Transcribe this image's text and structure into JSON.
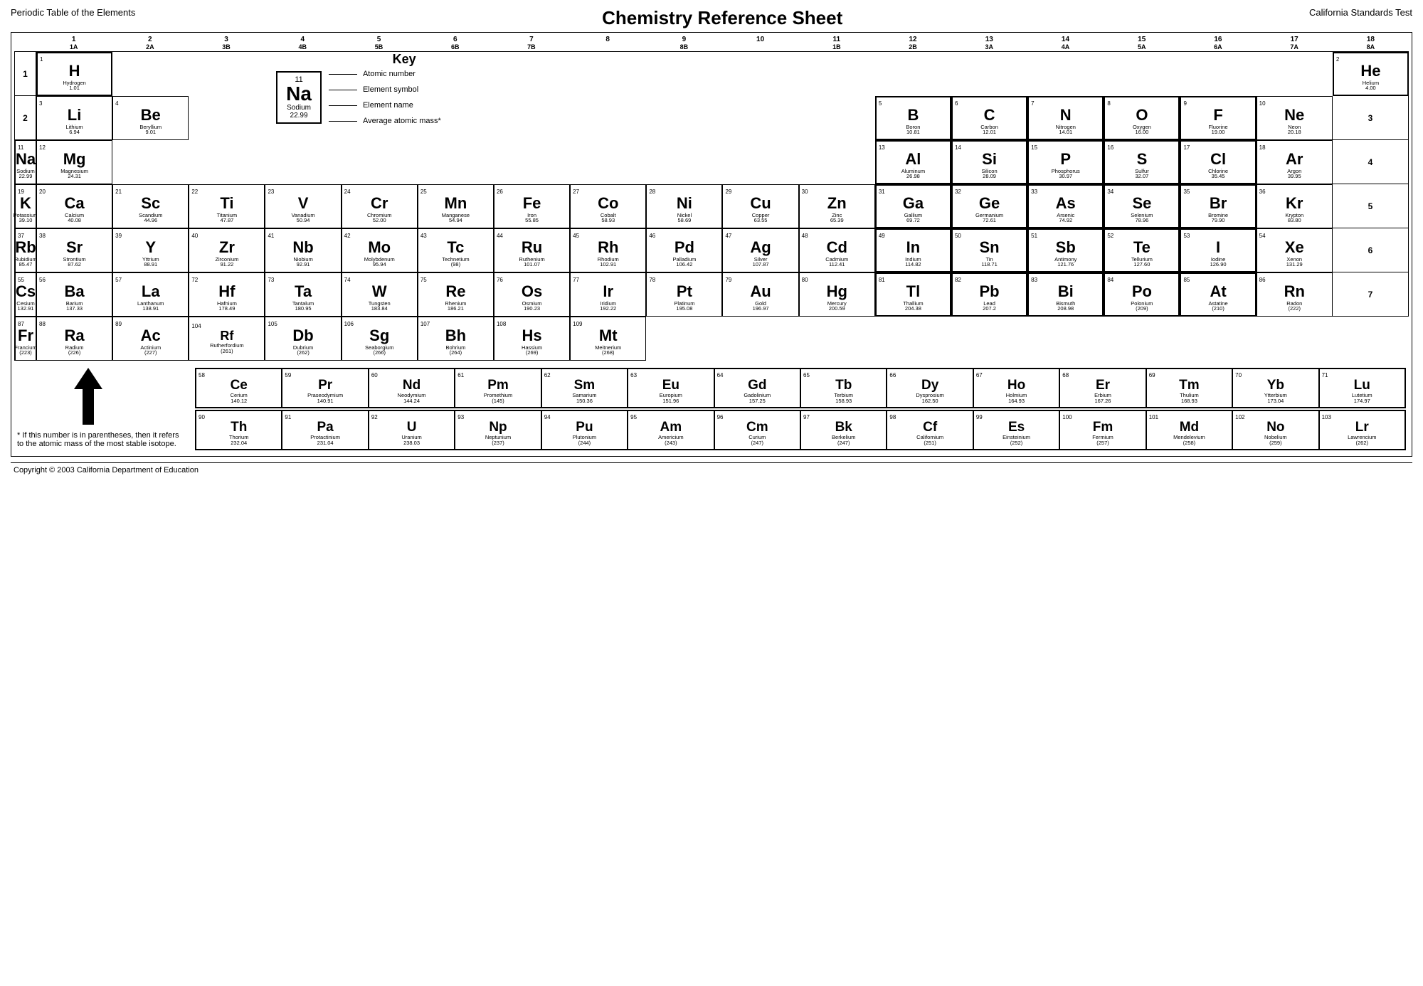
{
  "header": {
    "left": "Periodic Table of the Elements",
    "center": "Chemistry Reference Sheet",
    "right": "California Standards Test"
  },
  "key": {
    "title": "Key",
    "atomic_number_label": "Atomic number",
    "symbol_label": "Element symbol",
    "name_label": "Element name",
    "mass_label": "Average atomic mass*",
    "example": {
      "number": "11",
      "symbol": "Na",
      "name": "Sodium",
      "mass": "22.99"
    }
  },
  "footnote": "* If this number is in parentheses, then it refers to the atomic mass of the most stable isotope.",
  "copyright": "Copyright © 2003 California Department of Education",
  "groups": [
    "1",
    "2",
    "3",
    "4",
    "5",
    "6",
    "7",
    "8",
    "9",
    "10",
    "11",
    "12",
    "13",
    "14",
    "15",
    "16",
    "17",
    "18"
  ],
  "group_labels": [
    "1A",
    "2A",
    "",
    "",
    "",
    "",
    "",
    "",
    "8B",
    "",
    "",
    "",
    "3A",
    "4A",
    "5A",
    "6A",
    "7A",
    "8A"
  ],
  "group_sublabels": [
    "",
    "",
    "3B",
    "4B",
    "5B",
    "6B",
    "7B",
    "",
    "8B",
    "",
    "1B",
    "2B",
    "",
    "",
    "",
    "",
    "",
    ""
  ],
  "periods": [
    1,
    2,
    3,
    4,
    5,
    6,
    7
  ],
  "elements": {
    "H": {
      "number": 1,
      "symbol": "H",
      "name": "Hydrogen",
      "mass": "1.01"
    },
    "He": {
      "number": 2,
      "symbol": "He",
      "name": "Helium",
      "mass": "4.00"
    },
    "Li": {
      "number": 3,
      "symbol": "Li",
      "name": "Lithium",
      "mass": "6.94"
    },
    "Be": {
      "number": 4,
      "symbol": "Be",
      "name": "Beryllium",
      "mass": "9.01"
    },
    "B": {
      "number": 5,
      "symbol": "B",
      "name": "Boron",
      "mass": "10.81"
    },
    "C": {
      "number": 6,
      "symbol": "C",
      "name": "Carbon",
      "mass": "12.01"
    },
    "N": {
      "number": 7,
      "symbol": "N",
      "name": "Nitrogen",
      "mass": "14.01"
    },
    "O": {
      "number": 8,
      "symbol": "O",
      "name": "Oxygen",
      "mass": "16.00"
    },
    "F": {
      "number": 9,
      "symbol": "F",
      "name": "Fluorine",
      "mass": "19.00"
    },
    "Ne": {
      "number": 10,
      "symbol": "Ne",
      "name": "Neon",
      "mass": "20.18"
    },
    "Na": {
      "number": 11,
      "symbol": "Na",
      "name": "Sodium",
      "mass": "22.99"
    },
    "Mg": {
      "number": 12,
      "symbol": "Mg",
      "name": "Magnesium",
      "mass": "24.31"
    },
    "Al": {
      "number": 13,
      "symbol": "Al",
      "name": "Aluminum",
      "mass": "26.98"
    },
    "Si": {
      "number": 14,
      "symbol": "Si",
      "name": "Silicon",
      "mass": "28.09"
    },
    "P": {
      "number": 15,
      "symbol": "P",
      "name": "Phosphorus",
      "mass": "30.97"
    },
    "S": {
      "number": 16,
      "symbol": "S",
      "name": "Sulfur",
      "mass": "32.07"
    },
    "Cl": {
      "number": 17,
      "symbol": "Cl",
      "name": "Chlorine",
      "mass": "35.45"
    },
    "Ar": {
      "number": 18,
      "symbol": "Ar",
      "name": "Argon",
      "mass": "39.95"
    },
    "K": {
      "number": 19,
      "symbol": "K",
      "name": "Potassium",
      "mass": "39.10"
    },
    "Ca": {
      "number": 20,
      "symbol": "Ca",
      "name": "Calcium",
      "mass": "40.08"
    },
    "Sc": {
      "number": 21,
      "symbol": "Sc",
      "name": "Scandium",
      "mass": "44.96"
    },
    "Ti": {
      "number": 22,
      "symbol": "Ti",
      "name": "Titanium",
      "mass": "47.87"
    },
    "V": {
      "number": 23,
      "symbol": "V",
      "name": "Vanadium",
      "mass": "50.94"
    },
    "Cr": {
      "number": 24,
      "symbol": "Cr",
      "name": "Chromium",
      "mass": "52.00"
    },
    "Mn": {
      "number": 25,
      "symbol": "Mn",
      "name": "Manganese",
      "mass": "54.94"
    },
    "Fe": {
      "number": 26,
      "symbol": "Fe",
      "name": "Iron",
      "mass": "55.85"
    },
    "Co": {
      "number": 27,
      "symbol": "Co",
      "name": "Cobalt",
      "mass": "58.93"
    },
    "Ni": {
      "number": 28,
      "symbol": "Ni",
      "name": "Nickel",
      "mass": "58.69"
    },
    "Cu": {
      "number": 29,
      "symbol": "Cu",
      "name": "Copper",
      "mass": "63.55"
    },
    "Zn": {
      "number": 30,
      "symbol": "Zn",
      "name": "Zinc",
      "mass": "65.39"
    },
    "Ga": {
      "number": 31,
      "symbol": "Ga",
      "name": "Gallium",
      "mass": "69.72"
    },
    "Ge": {
      "number": 32,
      "symbol": "Ge",
      "name": "Germanium",
      "mass": "72.61"
    },
    "As": {
      "number": 33,
      "symbol": "As",
      "name": "Arsenic",
      "mass": "74.92"
    },
    "Se": {
      "number": 34,
      "symbol": "Se",
      "name": "Selenium",
      "mass": "78.96"
    },
    "Br": {
      "number": 35,
      "symbol": "Br",
      "name": "Bromine",
      "mass": "79.90"
    },
    "Kr": {
      "number": 36,
      "symbol": "Kr",
      "name": "Krypton",
      "mass": "83.80"
    },
    "Rb": {
      "number": 37,
      "symbol": "Rb",
      "name": "Rubidium",
      "mass": "85.47"
    },
    "Sr": {
      "number": 38,
      "symbol": "Sr",
      "name": "Strontium",
      "mass": "87.62"
    },
    "Y": {
      "number": 39,
      "symbol": "Y",
      "name": "Yttrium",
      "mass": "88.91"
    },
    "Zr": {
      "number": 40,
      "symbol": "Zr",
      "name": "Zirconium",
      "mass": "91.22"
    },
    "Nb": {
      "number": 41,
      "symbol": "Nb",
      "name": "Niobium",
      "mass": "92.91"
    },
    "Mo": {
      "number": 42,
      "symbol": "Mo",
      "name": "Molybdenum",
      "mass": "95.94"
    },
    "Tc": {
      "number": 43,
      "symbol": "Tc",
      "name": "Technetium",
      "mass": "(98)"
    },
    "Ru": {
      "number": 44,
      "symbol": "Ru",
      "name": "Ruthenium",
      "mass": "101.07"
    },
    "Rh": {
      "number": 45,
      "symbol": "Rh",
      "name": "Rhodium",
      "mass": "102.91"
    },
    "Pd": {
      "number": 46,
      "symbol": "Pd",
      "name": "Palladium",
      "mass": "106.42"
    },
    "Ag": {
      "number": 47,
      "symbol": "Ag",
      "name": "Silver",
      "mass": "107.87"
    },
    "Cd": {
      "number": 48,
      "symbol": "Cd",
      "name": "Cadmium",
      "mass": "112.41"
    },
    "In": {
      "number": 49,
      "symbol": "In",
      "name": "Indium",
      "mass": "114.82"
    },
    "Sn": {
      "number": 50,
      "symbol": "Sn",
      "name": "Tin",
      "mass": "118.71"
    },
    "Sb": {
      "number": 51,
      "symbol": "Sb",
      "name": "Antimony",
      "mass": "121.76"
    },
    "Te": {
      "number": 52,
      "symbol": "Te",
      "name": "Tellurium",
      "mass": "127.60"
    },
    "I": {
      "number": 53,
      "symbol": "I",
      "name": "Iodine",
      "mass": "126.90"
    },
    "Xe": {
      "number": 54,
      "symbol": "Xe",
      "name": "Xenon",
      "mass": "131.29"
    },
    "Cs": {
      "number": 55,
      "symbol": "Cs",
      "name": "Cesium",
      "mass": "132.91"
    },
    "Ba": {
      "number": 56,
      "symbol": "Ba",
      "name": "Barium",
      "mass": "137.33"
    },
    "La": {
      "number": 57,
      "symbol": "La",
      "name": "Lanthanum",
      "mass": "138.91"
    },
    "Hf": {
      "number": 72,
      "symbol": "Hf",
      "name": "Hafnium",
      "mass": "178.49"
    },
    "Ta": {
      "number": 73,
      "symbol": "Ta",
      "name": "Tantalum",
      "mass": "180.95"
    },
    "W": {
      "number": 74,
      "symbol": "W",
      "name": "Tungsten",
      "mass": "183.84"
    },
    "Re": {
      "number": 75,
      "symbol": "Re",
      "name": "Rhenium",
      "mass": "186.21"
    },
    "Os": {
      "number": 76,
      "symbol": "Os",
      "name": "Osmium",
      "mass": "190.23"
    },
    "Ir": {
      "number": 77,
      "symbol": "Ir",
      "name": "Iridium",
      "mass": "192.22"
    },
    "Pt": {
      "number": 78,
      "symbol": "Pt",
      "name": "Platinum",
      "mass": "195.08"
    },
    "Au": {
      "number": 79,
      "symbol": "Au",
      "name": "Gold",
      "mass": "196.97"
    },
    "Hg": {
      "number": 80,
      "symbol": "Hg",
      "name": "Mercury",
      "mass": "200.59"
    },
    "Tl": {
      "number": 81,
      "symbol": "Tl",
      "name": "Thallium",
      "mass": "204.38"
    },
    "Pb": {
      "number": 82,
      "symbol": "Pb",
      "name": "Lead",
      "mass": "207.2"
    },
    "Bi": {
      "number": 83,
      "symbol": "Bi",
      "name": "Bismuth",
      "mass": "208.98"
    },
    "Po": {
      "number": 84,
      "symbol": "Po",
      "name": "Polonium",
      "mass": "(209)"
    },
    "At": {
      "number": 85,
      "symbol": "At",
      "name": "Astatine",
      "mass": "(210)"
    },
    "Rn": {
      "number": 86,
      "symbol": "Rn",
      "name": "Radon",
      "mass": "(222)"
    },
    "Fr": {
      "number": 87,
      "symbol": "Fr",
      "name": "Francium",
      "mass": "(223)"
    },
    "Ra": {
      "number": 88,
      "symbol": "Ra",
      "name": "Radium",
      "mass": "(226)"
    },
    "Ac": {
      "number": 89,
      "symbol": "Ac",
      "name": "Actinium",
      "mass": "(227)"
    },
    "Rf": {
      "number": 104,
      "symbol": "Rf",
      "name": "Rutherfordium",
      "mass": "(261)"
    },
    "Db": {
      "number": 105,
      "symbol": "Db",
      "name": "Dubrium",
      "mass": "(262)"
    },
    "Sg": {
      "number": 106,
      "symbol": "Sg",
      "name": "Seaborgium",
      "mass": "(266)"
    },
    "Bh": {
      "number": 107,
      "symbol": "Bh",
      "name": "Bohrium",
      "mass": "(264)"
    },
    "Hs": {
      "number": 108,
      "symbol": "Hs",
      "name": "Hassium",
      "mass": "(269)"
    },
    "Mt": {
      "number": 109,
      "symbol": "Mt",
      "name": "Meitnerium",
      "mass": "(268)"
    },
    "Ce": {
      "number": 58,
      "symbol": "Ce",
      "name": "Cerium",
      "mass": "140.12"
    },
    "Pr": {
      "number": 59,
      "symbol": "Pr",
      "name": "Praseodymium",
      "mass": "140.91"
    },
    "Nd": {
      "number": 60,
      "symbol": "Nd",
      "name": "Neodymium",
      "mass": "144.24"
    },
    "Pm": {
      "number": 61,
      "symbol": "Pm",
      "name": "Promethium",
      "mass": "(145)"
    },
    "Sm": {
      "number": 62,
      "symbol": "Sm",
      "name": "Samarium",
      "mass": "150.36"
    },
    "Eu": {
      "number": 63,
      "symbol": "Eu",
      "name": "Europium",
      "mass": "151.96"
    },
    "Gd": {
      "number": 64,
      "symbol": "Gd",
      "name": "Gadolinium",
      "mass": "157.25"
    },
    "Tb": {
      "number": 65,
      "symbol": "Tb",
      "name": "Terbium",
      "mass": "158.93"
    },
    "Dy": {
      "number": 66,
      "symbol": "Dy",
      "name": "Dysprosium",
      "mass": "162.50"
    },
    "Ho": {
      "number": 67,
      "symbol": "Ho",
      "name": "Holmium",
      "mass": "164.93"
    },
    "Er": {
      "number": 68,
      "symbol": "Er",
      "name": "Erbium",
      "mass": "167.26"
    },
    "Tm": {
      "number": 69,
      "symbol": "Tm",
      "name": "Thulium",
      "mass": "168.93"
    },
    "Yb": {
      "number": 70,
      "symbol": "Yb",
      "name": "Ytterbium",
      "mass": "173.04"
    },
    "Lu": {
      "number": 71,
      "symbol": "Lu",
      "name": "Lutetium",
      "mass": "174.97"
    },
    "Th": {
      "number": 90,
      "symbol": "Th",
      "name": "Thorium",
      "mass": "232.04"
    },
    "Pa": {
      "number": 91,
      "symbol": "Pa",
      "name": "Protactinium",
      "mass": "231.04"
    },
    "U": {
      "number": 92,
      "symbol": "U",
      "name": "Uranium",
      "mass": "238.03"
    },
    "Np": {
      "number": 93,
      "symbol": "Np",
      "name": "Neptunium",
      "mass": "(237)"
    },
    "Pu": {
      "number": 94,
      "symbol": "Pu",
      "name": "Plutonium",
      "mass": "(244)"
    },
    "Am": {
      "number": 95,
      "symbol": "Am",
      "name": "Americium",
      "mass": "(243)"
    },
    "Cm": {
      "number": 96,
      "symbol": "Cm",
      "name": "Curium",
      "mass": "(247)"
    },
    "Bk": {
      "number": 97,
      "symbol": "Bk",
      "name": "Berkelium",
      "mass": "(247)"
    },
    "Cf": {
      "number": 98,
      "symbol": "Cf",
      "name": "Californium",
      "mass": "(251)"
    },
    "Es": {
      "number": 99,
      "symbol": "Es",
      "name": "Einsteinium",
      "mass": "(252)"
    },
    "Fm": {
      "number": 100,
      "symbol": "Fm",
      "name": "Fermium",
      "mass": "(257)"
    },
    "Md": {
      "number": 101,
      "symbol": "Md",
      "name": "Mendelevium",
      "mass": "(258)"
    },
    "No": {
      "number": 102,
      "symbol": "No",
      "name": "Nobelium",
      "mass": "(259)"
    },
    "Lr": {
      "number": 103,
      "symbol": "Lr",
      "name": "Lawrencium",
      "mass": "(262)"
    }
  }
}
